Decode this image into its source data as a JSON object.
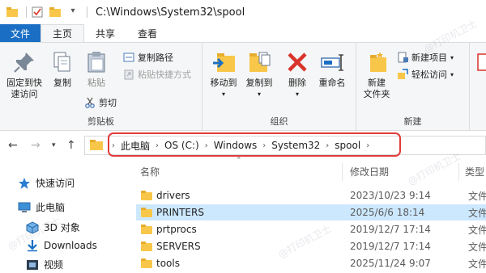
{
  "window": {
    "title": "C:\\Windows\\System32\\spool"
  },
  "ribbon_tabs": [
    {
      "label": "文件"
    },
    {
      "label": "主页"
    },
    {
      "label": "共享"
    },
    {
      "label": "查看"
    }
  ],
  "clipboard": {
    "pin_label_1": "固定到快",
    "pin_label_2": "速访问",
    "copy_label": "复制",
    "paste_label": "粘贴",
    "copy_path_label": "复制路径",
    "paste_shortcut_label": "粘贴快捷方式",
    "cut_label": "剪切",
    "group_label": "剪贴板"
  },
  "organize": {
    "move_to_label": "移动到",
    "copy_to_label": "复制到",
    "delete_label": "删除",
    "rename_label": "重命名",
    "group_label": "组织"
  },
  "new_group": {
    "new_folder_label_1": "新建",
    "new_folder_label_2": "文件夹",
    "new_item_label": "新建项目",
    "easy_access_label": "轻松访问",
    "group_label": "新建"
  },
  "address": {
    "crumbs": [
      "此电脑",
      "OS (C:)",
      "Windows",
      "System32",
      "spool"
    ]
  },
  "nav_pane": {
    "items": [
      {
        "label": "快速访问"
      },
      {
        "label": "此电脑"
      },
      {
        "label": "3D 对象"
      },
      {
        "label": "Downloads"
      },
      {
        "label": "视频"
      }
    ]
  },
  "file_list": {
    "columns": {
      "name": "名称",
      "date": "修改日期",
      "type": "类型"
    },
    "rows": [
      {
        "name": "drivers",
        "date": "2023/10/23 9:14",
        "type": "文件夹"
      },
      {
        "name": "PRINTERS",
        "date": "2025/6/6 18:14",
        "type": "文件夹"
      },
      {
        "name": "prtprocs",
        "date": "2019/12/7 17:14",
        "type": "文件夹"
      },
      {
        "name": "SERVERS",
        "date": "2019/12/7 17:14",
        "type": "文件夹"
      },
      {
        "name": "tools",
        "date": "2025/11/24 9:07",
        "type": "文件夹"
      }
    ]
  },
  "watermark_text": "@打印机卫士",
  "colors": {
    "accent": "#1a6fc4",
    "selection": "#cce8ff",
    "highlight_border": "#e03b3b",
    "folder": "#f8c74a"
  }
}
